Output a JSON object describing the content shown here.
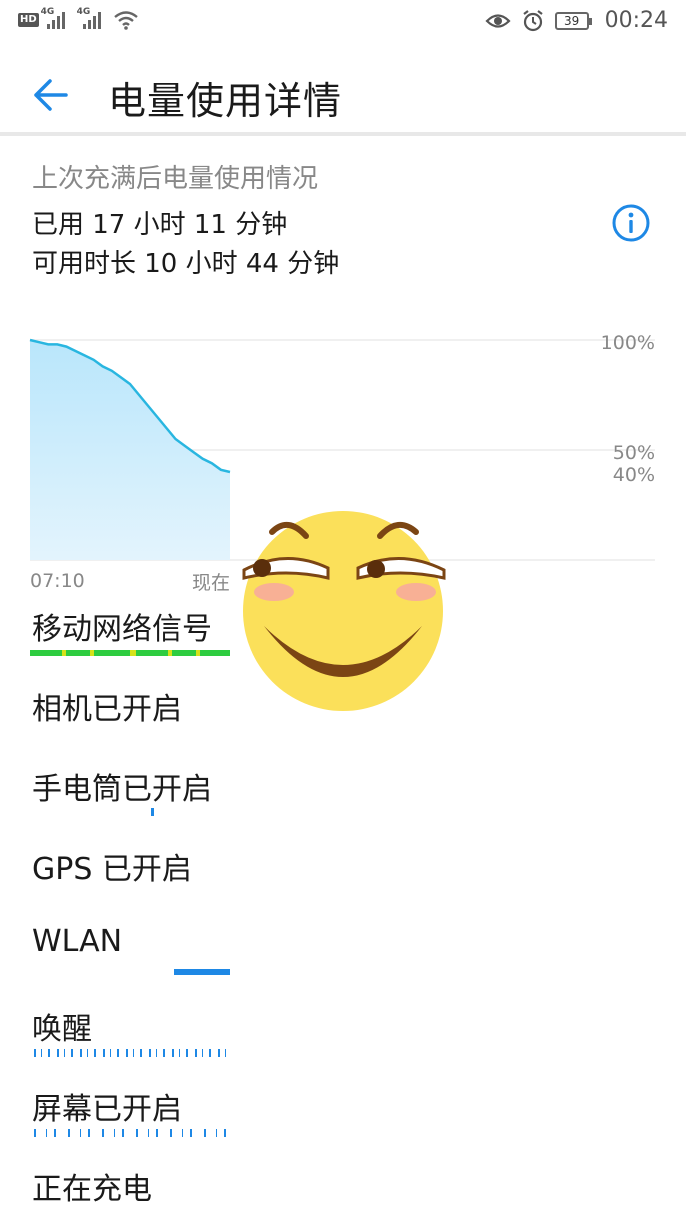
{
  "status_bar": {
    "hd": "HD",
    "net1": "4G",
    "net2": "4G",
    "battery": "39",
    "time": "00:24",
    "icons": [
      "eye-icon",
      "alarm-icon",
      "wifi-icon",
      "signal-icon"
    ]
  },
  "header": {
    "title": "电量使用详情"
  },
  "summary": {
    "subtitle": "上次充满后电量使用情况",
    "used": "已用 17 小时 11 分钟",
    "remaining": "可用时长 10 小时 44 分钟"
  },
  "chart_data": {
    "type": "area",
    "title": "",
    "xlabel": "",
    "ylabel": "",
    "x_tick_labels": [
      "07:10",
      "现在"
    ],
    "y_tick_labels": [
      "100%",
      "50%",
      "40%"
    ],
    "ylim": [
      0,
      100
    ],
    "series": [
      {
        "values": [
          100,
          99,
          98,
          98,
          97,
          95,
          93,
          91,
          88,
          86,
          83,
          80,
          75,
          70,
          65,
          60,
          55,
          52,
          49,
          46,
          44,
          41,
          40
        ]
      }
    ],
    "colors": {
      "line": "#29b6e0",
      "fill_top": "#b9e6fb",
      "fill_bottom": "#e3f4fd"
    }
  },
  "activity_rows": [
    {
      "label": "移动网络信号"
    },
    {
      "label": "相机已开启"
    },
    {
      "label": "手电筒已开启"
    },
    {
      "label": "GPS 已开启"
    },
    {
      "label": "WLAN"
    },
    {
      "label": "唤醒"
    },
    {
      "label": "屏幕已开启"
    },
    {
      "label": "正在充电"
    }
  ],
  "colors": {
    "accent": "#1e88e5",
    "signal_green": "#2ecc40",
    "signal_yellow": "#d6e21a",
    "activity_blue": "#1e88e5"
  }
}
